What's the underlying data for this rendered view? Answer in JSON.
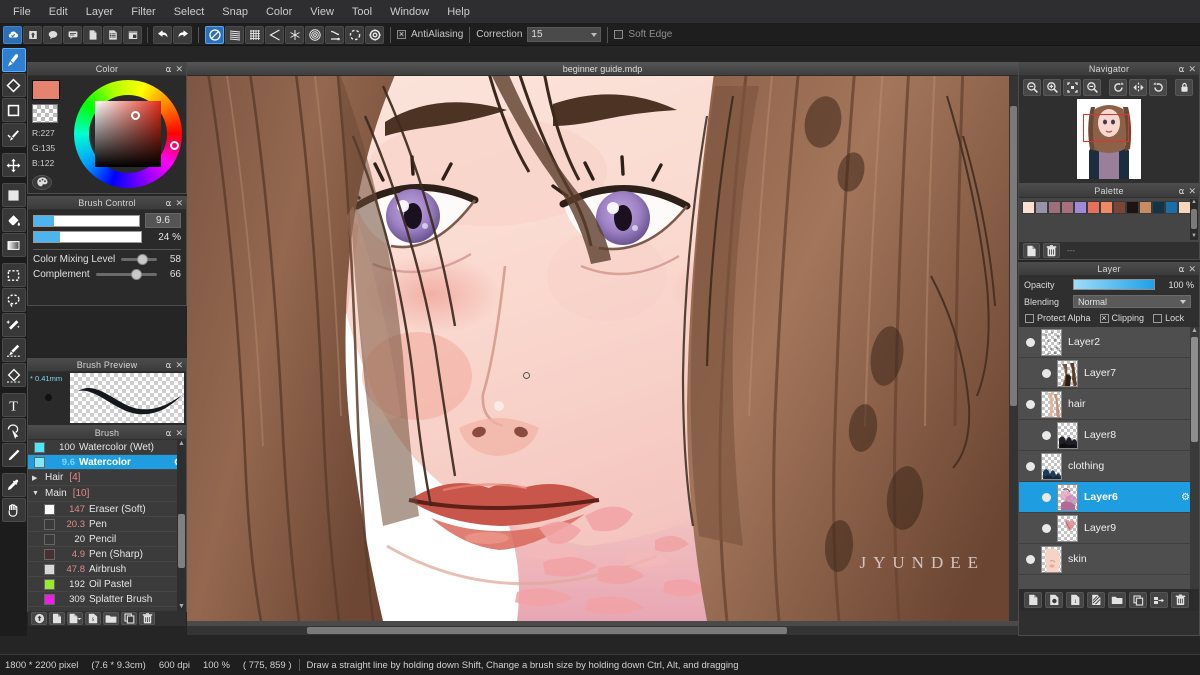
{
  "app": {
    "document_title": "beginner guide.mdp"
  },
  "menubar": {
    "items": [
      {
        "label": "File"
      },
      {
        "label": "Edit"
      },
      {
        "label": "Layer"
      },
      {
        "label": "Filter"
      },
      {
        "label": "Select"
      },
      {
        "label": "Snap"
      },
      {
        "label": "Color"
      },
      {
        "label": "View"
      },
      {
        "label": "Tool"
      },
      {
        "label": "Window"
      },
      {
        "label": "Help"
      }
    ]
  },
  "toolbar": {
    "left_buttons": [
      {
        "icon": "cloud-check-icon"
      },
      {
        "icon": "upload-icon"
      },
      {
        "icon": "comment-icon"
      },
      {
        "icon": "chat-icon"
      },
      {
        "icon": "new-document-icon"
      },
      {
        "icon": "list-document-icon"
      },
      {
        "icon": "grid-edit-icon"
      }
    ],
    "undo_icon": "undo-arrow-icon",
    "redo_icon": "redo-arrow-icon",
    "snap_buttons": [
      {
        "icon": "snap-off-icon",
        "active": true
      },
      {
        "icon": "parallel-lines-icon",
        "active": false
      },
      {
        "icon": "grid-snap-icon",
        "active": false
      },
      {
        "icon": "perspective-icon",
        "active": false
      },
      {
        "icon": "radial-icon",
        "active": false
      },
      {
        "icon": "concentric-circle-icon",
        "active": false
      },
      {
        "icon": "curve-icon",
        "active": false
      },
      {
        "icon": "circle-snap-icon",
        "active": false
      },
      {
        "icon": "gear-snap-icon",
        "active": false
      }
    ],
    "antialiasing_label": "AntiAliasing",
    "antialiasing_checked": true,
    "correction_label": "Correction",
    "correction_value": "15",
    "soft_edge_label": "Soft Edge",
    "soft_edge_checked": false
  },
  "tools": [
    {
      "name": "brush-tool",
      "icon": "brush-icon",
      "active": true
    },
    {
      "name": "eraser-tool",
      "icon": "eraser-icon",
      "active": false
    },
    {
      "name": "shape-tool",
      "icon": "square-outline-icon",
      "active": false
    },
    {
      "name": "pen-tool",
      "icon": "pen-nib-icon",
      "active": false
    },
    {
      "name": "move-tool",
      "icon": "move-arrows-icon",
      "active": false
    },
    {
      "name": "fill-rect-tool",
      "icon": "filled-square-icon",
      "active": false
    },
    {
      "name": "bucket-tool",
      "icon": "paint-bucket-icon",
      "active": false
    },
    {
      "name": "gradient-tool",
      "icon": "gradient-icon",
      "active": false
    },
    {
      "name": "select-rect-tool",
      "icon": "marquee-icon",
      "active": false
    },
    {
      "name": "lasso-tool",
      "icon": "lasso-icon",
      "active": false
    },
    {
      "name": "magic-wand-tool",
      "icon": "magic-wand-icon",
      "active": false
    },
    {
      "name": "select-brush-tool",
      "icon": "select-brush-icon",
      "active": false
    },
    {
      "name": "select-eraser-tool",
      "icon": "select-eraser-icon",
      "active": false
    },
    {
      "name": "text-tool",
      "icon": "text-t-icon",
      "active": false
    },
    {
      "name": "transform-select-tool",
      "icon": "transform-cursor-icon",
      "active": false
    },
    {
      "name": "pencil-tool",
      "icon": "pencil-icon",
      "active": false
    },
    {
      "name": "eyedropper-tool",
      "icon": "eyedropper-icon",
      "active": false
    },
    {
      "name": "hand-tool",
      "icon": "hand-icon",
      "active": false
    }
  ],
  "color_panel": {
    "title": "Color",
    "foreground": "#e5836f",
    "rgb": {
      "r": "R:227",
      "g": "G:135",
      "b": "B:122"
    },
    "palette_icon": "palette-icon"
  },
  "brush_control": {
    "title": "Brush Control",
    "size_value": "9.6",
    "size_percent": 19,
    "opacity_value": "24 %",
    "opacity_percent": 24,
    "sliders": [
      {
        "label": "Color Mixing Level",
        "value": "58",
        "percent": 58
      },
      {
        "label": "Complement",
        "value": "66",
        "percent": 66
      }
    ]
  },
  "brush_preview": {
    "title": "Brush Preview",
    "size_mm": "* 0.41mm"
  },
  "brush_panel": {
    "title": "Brush",
    "items": [
      {
        "type": "brush",
        "size": "100",
        "name": "Watercolor (Wet)",
        "chip": "#4fe6f5",
        "selected": false,
        "indent": 0
      },
      {
        "type": "brush",
        "size": "9.6",
        "name": "Watercolor",
        "chip": "#7fe7f8",
        "selected": true,
        "indent": 0,
        "gear": "⚙"
      },
      {
        "type": "group",
        "name": "Hair",
        "count": "[4]",
        "expanded": false
      },
      {
        "type": "group",
        "name": "Main",
        "count": "[10]",
        "expanded": true
      },
      {
        "type": "brush",
        "size": "147",
        "name": "Eraser (Soft)",
        "chip": "#ffffff",
        "selected": false,
        "indent": 1
      },
      {
        "type": "brush",
        "size": "20.3",
        "name": "Pen",
        "chip": "#3a3a3a",
        "selected": false,
        "indent": 1
      },
      {
        "type": "brush",
        "size": "20",
        "name": "Pencil",
        "chip": "#3a3a3a",
        "selected": false,
        "indent": 1
      },
      {
        "type": "brush",
        "size": "4.9",
        "name": "Pen (Sharp)",
        "chip": "#4a3030",
        "selected": false,
        "indent": 1
      },
      {
        "type": "brush",
        "size": "47.8",
        "name": "Airbrush",
        "chip": "#d8d8d8",
        "selected": false,
        "indent": 1
      },
      {
        "type": "brush",
        "size": "192",
        "name": "Oil Pastel",
        "chip": "#9ae830",
        "selected": false,
        "indent": 1
      },
      {
        "type": "brush",
        "size": "309",
        "name": "Splatter Brush",
        "chip": "#ea20ea",
        "selected": false,
        "indent": 1
      }
    ],
    "footer_buttons": [
      {
        "icon": "import-brush-icon"
      },
      {
        "icon": "new-brush-icon"
      },
      {
        "icon": "add-brush-dropdown-icon"
      },
      {
        "icon": "script-brush-icon"
      },
      {
        "icon": "folder-icon"
      },
      {
        "icon": "duplicate-icon"
      },
      {
        "icon": "trash-icon"
      }
    ]
  },
  "navigator": {
    "title": "Navigator",
    "buttons": [
      {
        "icon": "zoom-reset-icon"
      },
      {
        "icon": "zoom-in-icon"
      },
      {
        "icon": "fit-screen-icon"
      },
      {
        "icon": "zoom-out-icon"
      },
      {
        "icon": "rotate-left-icon"
      },
      {
        "icon": "flip-horizontal-icon"
      },
      {
        "icon": "rotate-right-icon"
      },
      {
        "icon": "lock-rotation-icon"
      }
    ]
  },
  "palette": {
    "title": "Palette",
    "swatches": [
      "#fbe0cf",
      "#9a93a8",
      "#9d6f7c",
      "#a8707f",
      "#a089d6",
      "#e5705c",
      "#ef8a66",
      "#7a4436",
      "#1c1410",
      "#c98b62",
      "#123448",
      "#1a6fa8",
      "#f6d7bc"
    ],
    "footer_buttons": [
      {
        "icon": "new-palette-icon"
      },
      {
        "icon": "delete-palette-icon"
      }
    ],
    "footer_text": "---"
  },
  "layer_panel": {
    "title": "Layer",
    "opacity_label": "Opacity",
    "opacity_value": "100 %",
    "opacity_percent": 100,
    "blending_label": "Blending",
    "blending_value": "Normal",
    "checkboxes": [
      {
        "label": "Protect Alpha",
        "checked": false
      },
      {
        "label": "Clipping",
        "checked": true
      },
      {
        "label": "Lock",
        "checked": false
      }
    ],
    "layers": [
      {
        "name": "Layer2",
        "visible": true,
        "selected": false,
        "indent": 0,
        "thumb": "noise"
      },
      {
        "name": "Layer7",
        "visible": true,
        "selected": false,
        "indent": 1,
        "thumb": "hairdark"
      },
      {
        "name": "hair",
        "visible": true,
        "selected": false,
        "indent": 0,
        "thumb": "hair"
      },
      {
        "name": "Layer8",
        "visible": true,
        "selected": false,
        "indent": 1,
        "thumb": "dark"
      },
      {
        "name": "clothing",
        "visible": true,
        "selected": false,
        "indent": 0,
        "thumb": "cloth"
      },
      {
        "name": "Layer6",
        "visible": true,
        "selected": true,
        "indent": 1,
        "thumb": "pink",
        "gear": "⚙"
      },
      {
        "name": "Layer9",
        "visible": true,
        "selected": false,
        "indent": 1,
        "thumb": "small"
      },
      {
        "name": "skin",
        "visible": true,
        "selected": false,
        "indent": 0,
        "thumb": "skin"
      }
    ],
    "footer_buttons": [
      {
        "icon": "add-layer-icon"
      },
      {
        "icon": "add-8bit-layer-icon"
      },
      {
        "icon": "add-1bit-layer-icon"
      },
      {
        "icon": "add-halftone-layer-icon"
      },
      {
        "icon": "add-folder-icon"
      },
      {
        "icon": "duplicate-layer-icon"
      },
      {
        "icon": "merge-layer-icon"
      },
      {
        "icon": "delete-layer-icon"
      }
    ]
  },
  "canvas": {
    "watermark": "JYUNDEE"
  },
  "statusbar": {
    "dimensions": "1800 * 2200 pixel",
    "physical": "(7.6 * 9.3cm)",
    "dpi": "600 dpi",
    "zoom": "100 %",
    "coords": "( 775, 859 )",
    "hint": "Draw a straight line by holding down Shift, Change a brush size by holding down Ctrl, Alt, and dragging"
  }
}
